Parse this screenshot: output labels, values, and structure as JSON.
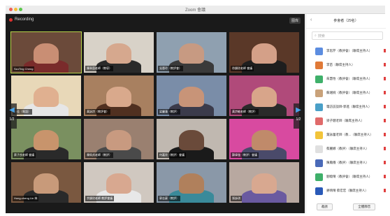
{
  "window": {
    "title": "Zoom 會議"
  },
  "video": {
    "recording": "Recording",
    "view_button": "图库",
    "prev_page": "1/2",
    "next_page": "1/2",
    "tiles": [
      {
        "label": "SzuTing Cheng",
        "bg": "#6b4a3a",
        "skin": "#c98e74",
        "shirt": "#7a2b2b",
        "active": true
      },
      {
        "label": "陳翠茵老師（教導）",
        "bg": "#d8d2c8",
        "skin": "#d6a88e",
        "shirt": "#2a2a2a"
      },
      {
        "label": "吳蕙玲（教評會）",
        "bg": "#8fa0b0",
        "skin": "#c79a82",
        "shirt": "#3a3a3a"
      },
      {
        "label": "徐穎欣老師 會議",
        "bg": "#5a3828",
        "skin": "#d4a088",
        "shirt": "#1e1e1e"
      },
      {
        "label": "毛佳（粵語）",
        "bg": "#e8d8b8",
        "skin": "#e0b090",
        "shirt": "#e6e6e6"
      },
      {
        "label": "黃詠詩（教評會）",
        "bg": "#a88060",
        "skin": "#d9a98c",
        "shirt": "#503020"
      },
      {
        "label": "梁麗蓮（教評）",
        "bg": "#7a8da8",
        "skin": "#c89478",
        "shirt": "#3b3b4b"
      },
      {
        "label": "黃詩敏老師（教評）",
        "bg": "#b04a7a",
        "skin": "#d8a58a",
        "shirt": "#2a2a2a"
      },
      {
        "label": "蔡子良老師 會議",
        "bg": "#7a9060",
        "skin": "#c8946c",
        "shirt": "#2a2a2a"
      },
      {
        "label": "陳佩貞老師（教評）",
        "bg": "#9a8070",
        "skin": "#c89a80",
        "shirt": "#4a4a4a"
      },
      {
        "label": "何嘉欣（教評）會議",
        "bg": "#c0b8b0",
        "skin": "#6a4a3a",
        "shirt": "#1a1a1a"
      },
      {
        "label": "鄭偉強（教評）會議",
        "bg": "#d84aa0",
        "skin": "#c08a6a",
        "shirt": "#4a4a6a"
      },
      {
        "label": "Hong-cheng Lin 林",
        "bg": "#7a5840",
        "skin": "#c89a7a",
        "shirt": "#2a2a2a"
      },
      {
        "label": "余穎欣老師 教評會議",
        "bg": "#d0c8c0",
        "skin": "#d8a890",
        "shirt": "#e8e8e8"
      },
      {
        "label": "郭志豪（教評）",
        "bg": "#8a98a8",
        "skin": "#b0805c",
        "shirt": "#3a8a9a"
      },
      {
        "label": "張詠琪",
        "bg": "#b8a8a0",
        "skin": "#d8a890",
        "shirt": "#6a5aa0"
      }
    ]
  },
  "participants": {
    "back_label": "‹",
    "title": "參會者（29名）",
    "search_placeholder": "搜索",
    "list": [
      {
        "name": "李思芹（教評會）（聯席主持人）",
        "color": "#5c8de0"
      },
      {
        "name": "李苗（聯席主持人）",
        "color": "#e07a38"
      },
      {
        "name": "朱慧怡（教評會）（聯席主持人）",
        "color": "#3fb06a"
      },
      {
        "name": "蘇湘婉（教評會）（聯席主持人）",
        "color": "#c9a27a"
      },
      {
        "name": "電訪訪談師-郭進（聯席主持人）",
        "color": "#4aa0c8"
      },
      {
        "name": "梁子健老師（聯席主持人）",
        "color": "#e06a6a"
      },
      {
        "name": "葉詠蕾老師（教...（聯席主持人）",
        "color": "#f2c43a"
      },
      {
        "name": "蔡麗娜（教評）（聯席主持人）",
        "color": "#e0e0e0"
      },
      {
        "name": "陳鳳儀（教評）（聯席主持人）",
        "color": "#4a6ab8"
      },
      {
        "name": "劉曉晴（教評會）（聯席主持人）",
        "color": "#3fb06a"
      },
      {
        "name": "麥晴晴 蔡宏宏（聯席主持人）",
        "color": "#2a5ab8"
      }
    ],
    "invite_button": "邀請",
    "mute_all_button": "全體靜音"
  }
}
